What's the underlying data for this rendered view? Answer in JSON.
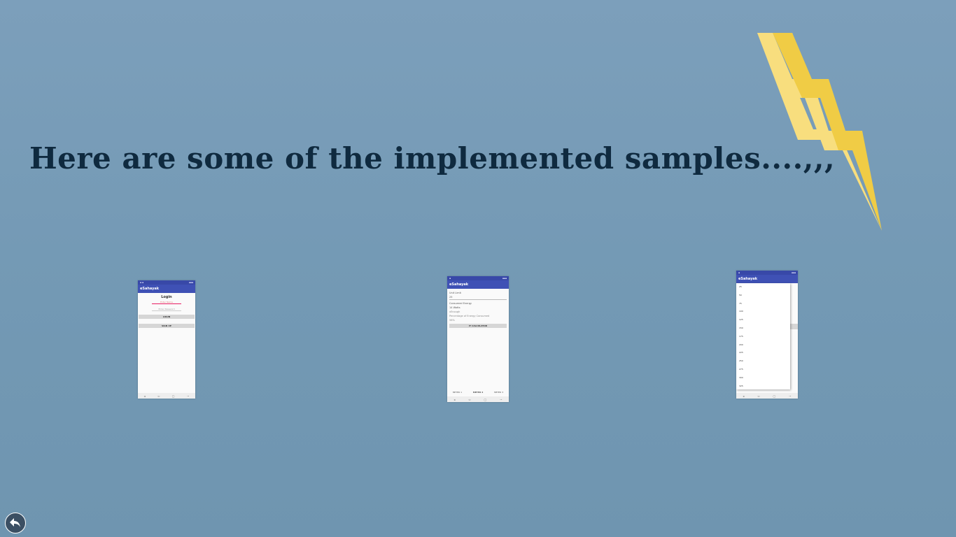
{
  "slide": {
    "title": "Here are some of the implemented samples....,,,"
  },
  "colors": {
    "background": "#7399b4",
    "title": "#0f2a3f",
    "bolt_dark": "#f0cc45",
    "bolt_light": "#f8de7e",
    "app_primary": "#3f51b5"
  },
  "screens": {
    "login": {
      "app_title": "eSahayak",
      "heading": "Login",
      "username_placeholder": "Enter Name",
      "password_placeholder": "Enter Password",
      "login_label": "LOGIN",
      "signup_label": "SIGN UP"
    },
    "calculator": {
      "app_title": "eSahayak",
      "unit_label": "Unit Limit",
      "unit_value": "25",
      "consumed_label": "Consumed Energy",
      "consumed_value": "14 Watts",
      "message": "xEnough",
      "percent_label": "Percentage of Energy Consumed",
      "percent_value": "56%",
      "calc_button": "IT CALCULATOR",
      "tabs": [
        "METER 1",
        "METER 2",
        "METER 3"
      ]
    },
    "dropdown": {
      "app_title": "eSahayak",
      "options": [
        "25",
        "50",
        "75",
        "100",
        "125",
        "150",
        "175",
        "200",
        "225",
        "250",
        "275",
        "300",
        "325"
      ]
    }
  },
  "icons": {
    "back": "undo-arrow-icon",
    "bolt": "lightning-bolt-icon"
  }
}
